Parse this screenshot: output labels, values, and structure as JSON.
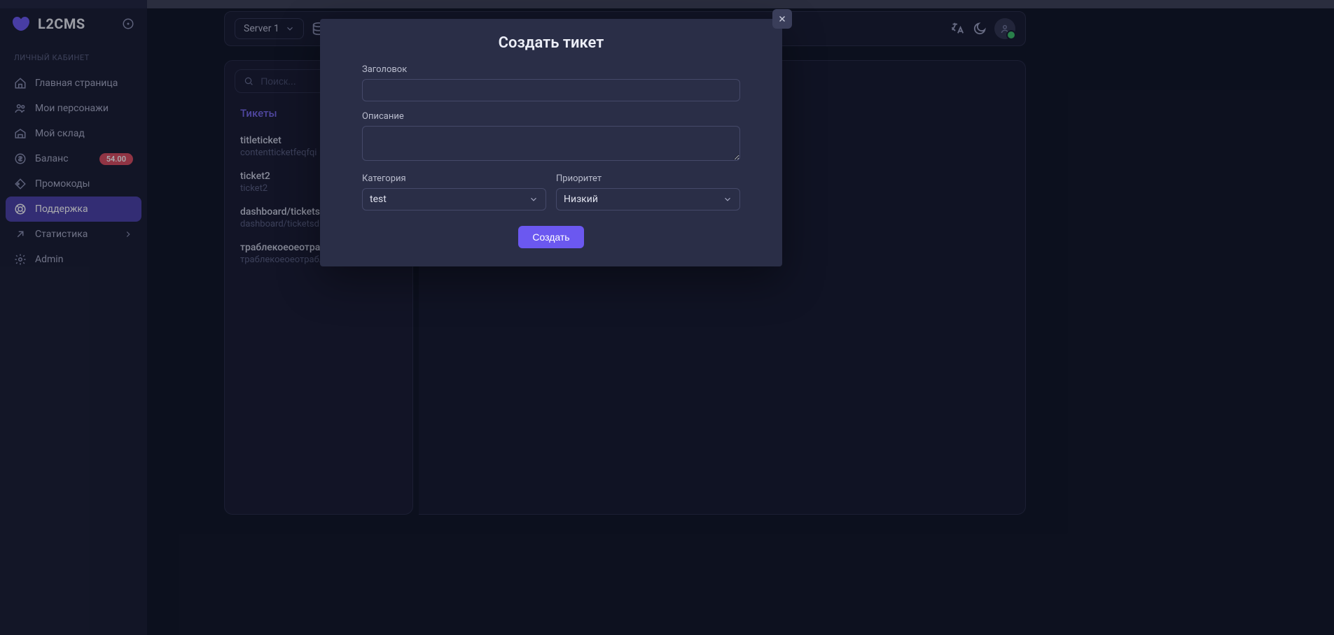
{
  "brand": {
    "name": "L2CMS"
  },
  "sidebar": {
    "section": "ЛИЧНЫЙ КАБИНЕТ",
    "items": [
      {
        "label": "Главная страница"
      },
      {
        "label": "Мои персонажи"
      },
      {
        "label": "Мой склад"
      },
      {
        "label": "Баланс",
        "badge": "54.00"
      },
      {
        "label": "Промокоды"
      },
      {
        "label": "Поддержка"
      },
      {
        "label": "Статистика"
      },
      {
        "label": "Admin"
      }
    ]
  },
  "topbar": {
    "server": "Server 1"
  },
  "tickets": {
    "search_placeholder": "Поиск...",
    "heading": "Тикеты",
    "list": [
      {
        "title": "titleticket",
        "sub": "contentticketfeqfqi"
      },
      {
        "title": "ticket2",
        "sub": "ticket2"
      },
      {
        "title": "dashboard/tickets",
        "sub": "dashboard/ticketsd"
      },
      {
        "title": "траблекоеоеотрабл",
        "sub": "траблекоеоеотрабл"
      }
    ]
  },
  "modal": {
    "title": "Создать тикет",
    "label_title": "Заголовок",
    "label_desc": "Описание",
    "label_category": "Категория",
    "label_priority": "Приоритет",
    "category_value": "test",
    "priority_value": "Низкий",
    "submit": "Создать"
  },
  "colors": {
    "accent": "#6b58f0",
    "badge": "#d94a5c"
  }
}
